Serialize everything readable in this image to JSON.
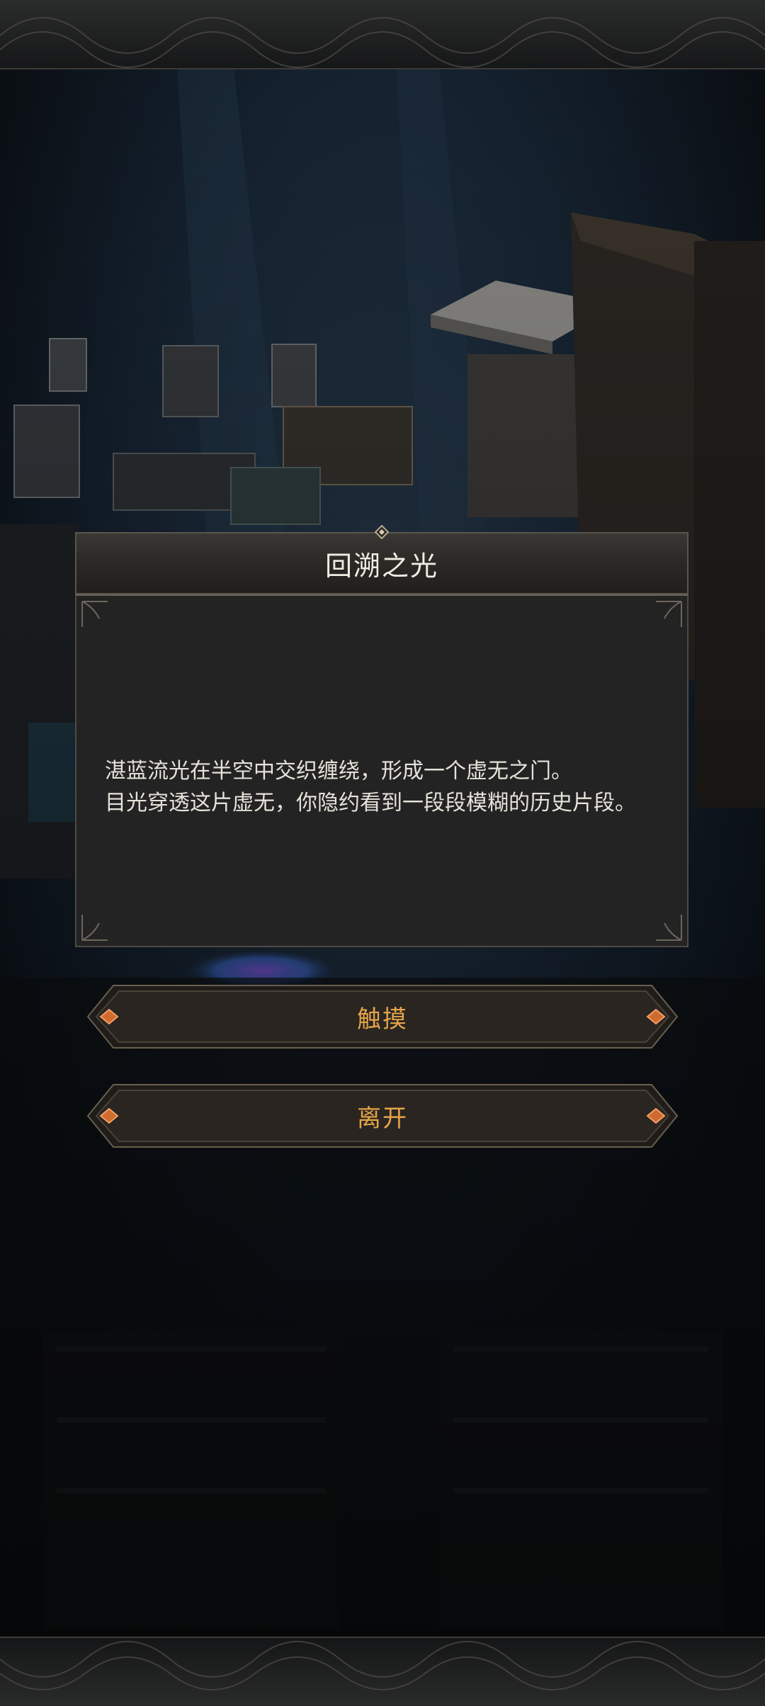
{
  "dialog": {
    "title": "回溯之光",
    "lines": [
      "湛蓝流光在半空中交织缠绕，形成一个虚无之门。",
      "目光穿透这片虚无，你隐约看到一段段模糊的历史片段。"
    ]
  },
  "choices": [
    {
      "label": "触摸"
    },
    {
      "label": "离开"
    }
  ],
  "colors": {
    "title_text": "#f1ece2",
    "body_text": "#e6e2da",
    "choice_text": "#e3a44a",
    "choice_gem": "#d06a2e",
    "panel_bg": "#232323"
  }
}
